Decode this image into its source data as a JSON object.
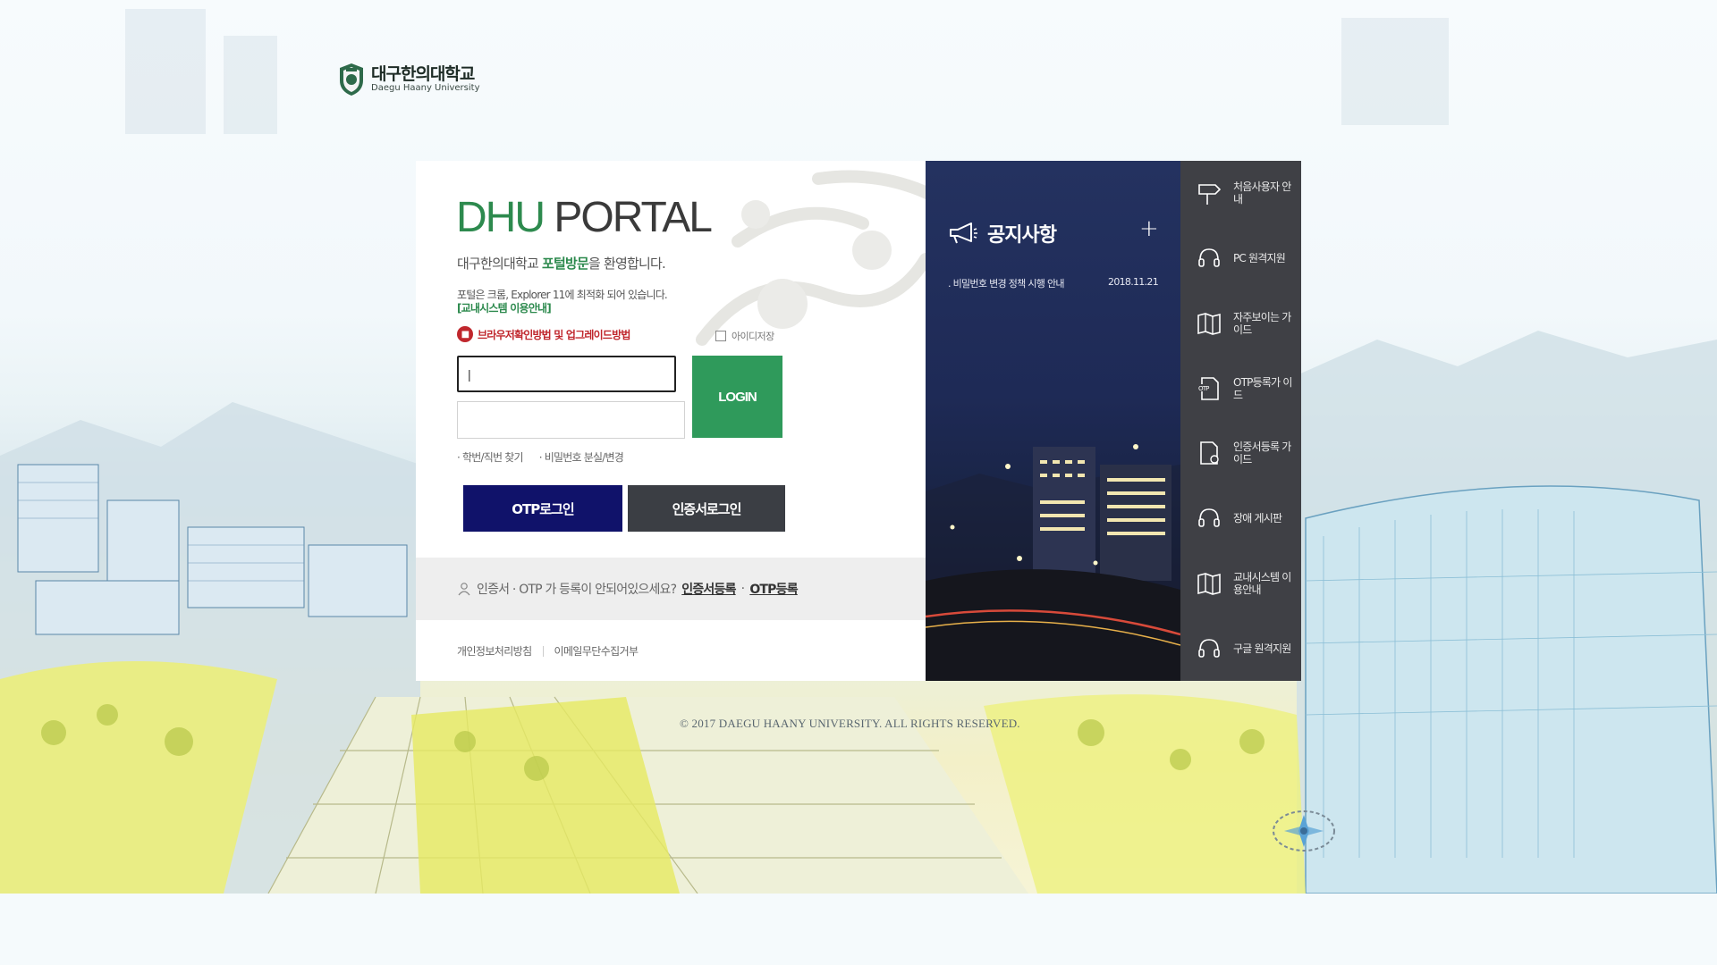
{
  "logo": {
    "name_ko": "대구한의대학교",
    "name_en": "Daegu Haany University"
  },
  "login": {
    "title_dhu": "DHU",
    "title_portal": "PORTAL",
    "welcome_prefix": "대구한의대학교 ",
    "welcome_highlight": "포털방문",
    "welcome_suffix": "을 환영합니다.",
    "browser_notice": "포털은 크롬, Explorer 11에 최적화 되어 있습니다.",
    "system_guide_link": "[교내시스템 이용안내]",
    "browser_guide_link": "브라우저확인방법 및 업그레이드방법",
    "save_id_label": "아이디저장",
    "id_value": "|",
    "id_placeholder": "",
    "pw_placeholder": "",
    "login_button": "LOGIN",
    "find_id": "학번/직번 찾기",
    "find_pw": "비밀번호 분실/변경",
    "otp_login": "OTP로그인",
    "cert_login": "인증서로그인",
    "register_question": "인증서 · OTP 가 등록이 안되어있으세요?",
    "cert_register": "인증서등록",
    "dot": "·",
    "otp_register": "OTP등록",
    "privacy_policy": "개인정보처리방침",
    "email_refusal": "이메일무단수집거부"
  },
  "notice": {
    "title": "공지사항",
    "plus": "+",
    "items": [
      {
        "title": "비밀번호 변경 정책 시행 안내",
        "date": "2018.11.21"
      }
    ]
  },
  "quick_menu": {
    "items": [
      {
        "label": "처음사용자 안내",
        "icon": "signpost-icon"
      },
      {
        "label": "PC 원격지원",
        "icon": "headset-icon"
      },
      {
        "label": "자주보이는 가이드",
        "icon": "book-icon"
      },
      {
        "label": "OTP등록가 이드",
        "icon": "otp-document-icon"
      },
      {
        "label": "인증서등록 가이드",
        "icon": "certificate-document-icon"
      },
      {
        "label": "장애 게시판",
        "icon": "headset-icon"
      },
      {
        "label": "교내시스템 이용안내",
        "icon": "book-icon"
      },
      {
        "label": "구글 원격지원",
        "icon": "headset-icon"
      }
    ]
  },
  "copyright": "© 2017 DAEGU HAANY UNIVERSITY. ALL RIGHTS RESERVED.",
  "colors": {
    "brand_green": "#2f9a5b",
    "otp_navy": "#10126a",
    "cert_gray": "#3b3e44",
    "warning_red": "#c0272d",
    "quick_menu_bg": "#3f4045",
    "notice_bg": "#243260"
  }
}
